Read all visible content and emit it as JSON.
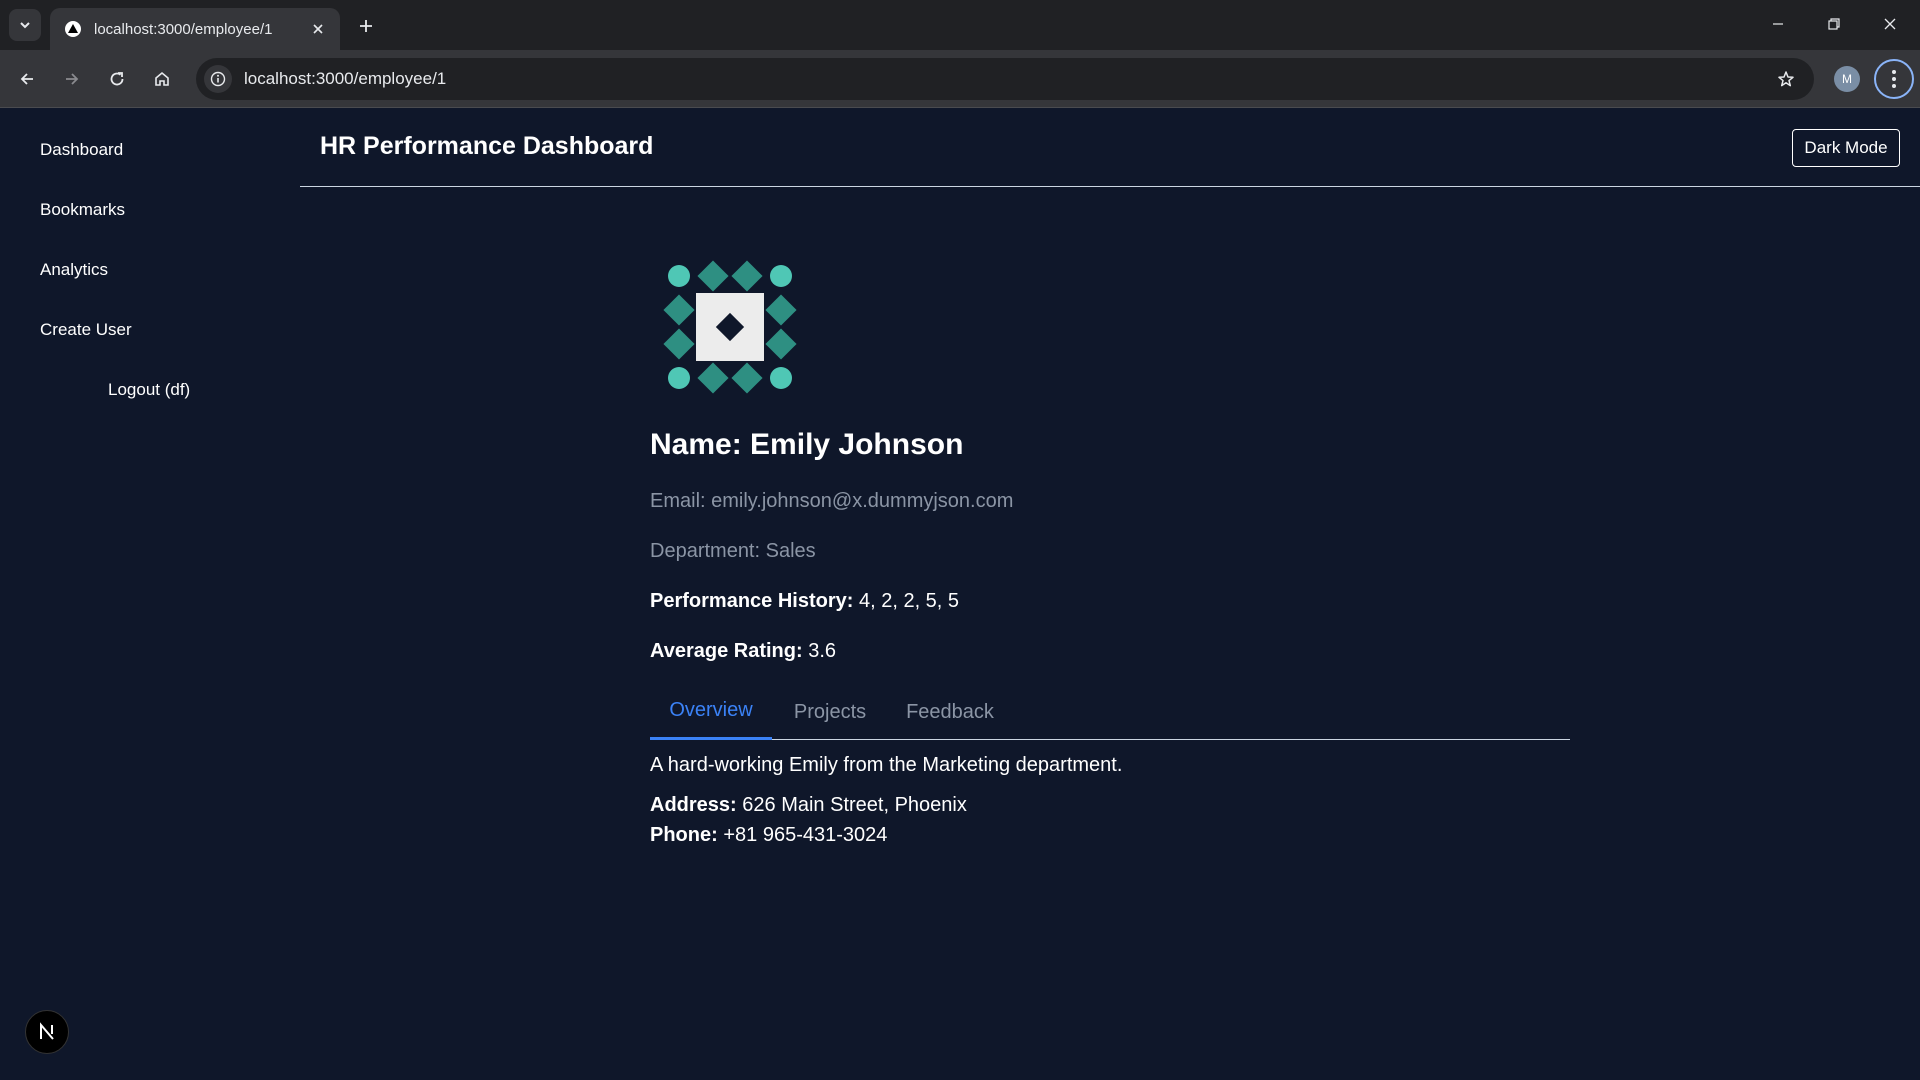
{
  "browser": {
    "tab_title": "localhost:3000/employee/1",
    "url": "localhost:3000/employee/1",
    "profile_initial": "M"
  },
  "sidebar": {
    "items": [
      {
        "label": "Dashboard"
      },
      {
        "label": "Bookmarks"
      },
      {
        "label": "Analytics"
      },
      {
        "label": "Create User"
      }
    ],
    "logout_label": "Logout (df)"
  },
  "header": {
    "title": "HR Performance Dashboard",
    "theme_button": "Dark Mode"
  },
  "employee": {
    "name_label": "Name: ",
    "name": "Emily Johnson",
    "email_label": "Email: ",
    "email": "emily.johnson@x.dummyjson.com",
    "department_label": "Department: ",
    "department": "Sales",
    "performance_label": "Performance History:",
    "performance_history": "4, 2, 2, 5, 5",
    "average_label": "Average Rating:",
    "average_rating": "3.6"
  },
  "tabs": [
    {
      "label": "Overview",
      "active": true
    },
    {
      "label": "Projects",
      "active": false
    },
    {
      "label": "Feedback",
      "active": false
    }
  ],
  "overview": {
    "bio": "A hard-working Emily from the Marketing department.",
    "address_label": "Address:",
    "address": "626 Main Street, Phoenix",
    "phone_label": "Phone:",
    "phone": "+81 965-431-3024"
  },
  "dev_badge_letter": "N",
  "colors": {
    "background": "#0f172a",
    "accent": "#3b82f6",
    "avatar_teal": "#4fc7b5",
    "avatar_teal_dark": "#2e8f82"
  }
}
